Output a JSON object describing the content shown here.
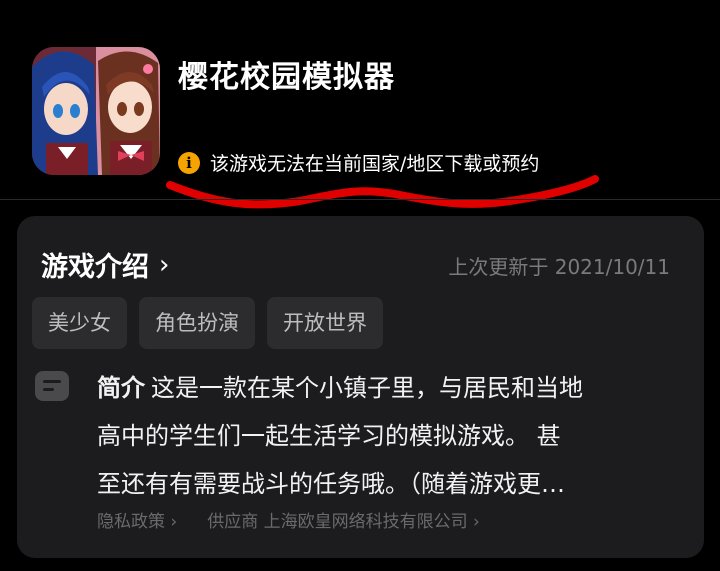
{
  "app": {
    "title": "樱花校园模拟器",
    "notice": "该游戏无法在当前国家/地区下载或预约",
    "icon_name": "sakura-school-app-icon"
  },
  "intro": {
    "title": "游戏介绍",
    "updated": "上次更新于 2021/10/11",
    "tags": [
      "美少女",
      "角色扮演",
      "开放世界"
    ],
    "description_label": "简介",
    "description_lines": [
      "这是一款在某个小镇子里，与居民和当地",
      "高中的学生们一起生活学习的模拟游戏。 甚",
      "至还有有需要战斗的任务哦。（随着游戏更…"
    ],
    "privacy_link": "隐私政策 ›",
    "provider_link": "供应商 上海欧皇网络科技有限公司 ›"
  },
  "colors": {
    "background": "#000000",
    "card": "#1c1c1e",
    "info_icon": "#f5a300",
    "annotation_red": "#e00000"
  }
}
